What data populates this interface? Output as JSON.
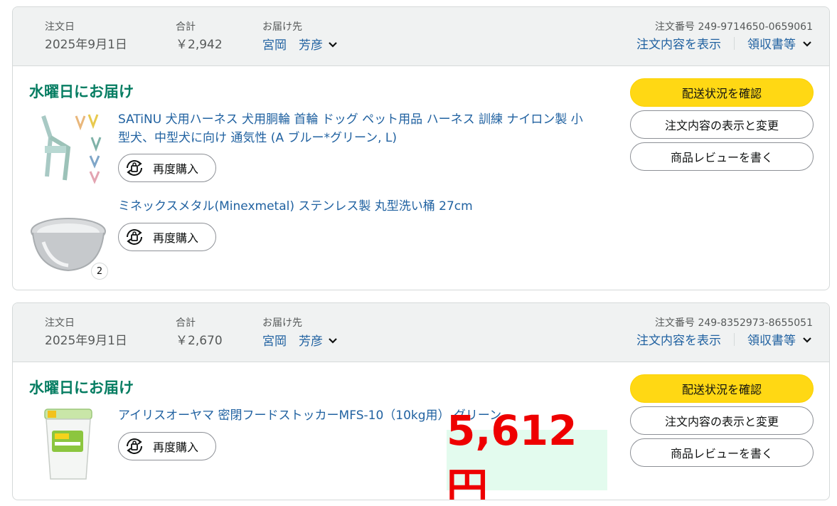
{
  "orders": [
    {
      "date_label": "注文日",
      "date": "2025年9月1日",
      "total_label": "合計",
      "total": "￥2,942",
      "ship_label": "お届け先",
      "ship_to": "宮岡　芳彦",
      "order_no": "注文番号 249-9714650-0659061",
      "view_details": "注文内容を表示",
      "receipt": "領収書等",
      "delivery": "水曜日にお届け",
      "items": [
        {
          "title": "SATiNU 犬用ハーネス 犬用胴輪 首輪 ドッグ ペット用品 ハーネス 訓練 ナイロン製 小型犬、中型犬に向け 通気性 (A ブルー*グリーン, L)",
          "rebuy": "再度購入",
          "image_icon": "harness-image"
        },
        {
          "title": "ミネックスメタル(Minexmetal) ステンレス製 丸型洗い桶 27cm",
          "rebuy": "再度購入",
          "qty": "2",
          "image_icon": "steel-bowl-image"
        }
      ],
      "buttons": {
        "track": "配送状況を確認",
        "edit": "注文内容の表示と変更",
        "review": "商品レビューを書く"
      }
    },
    {
      "date_label": "注文日",
      "date": "2025年9月1日",
      "total_label": "合計",
      "total": "￥2,670",
      "ship_label": "お届け先",
      "ship_to": "宮岡　芳彦",
      "order_no": "注文番号 249-8352973-8655051",
      "view_details": "注文内容を表示",
      "receipt": "領収書等",
      "delivery": "水曜日にお届け",
      "items": [
        {
          "title": "アイリスオーヤマ 密閉フードストッカーMFS-10（10kg用） グリーン",
          "rebuy": "再度購入",
          "image_icon": "food-stocker-image"
        }
      ],
      "buttons": {
        "track": "配送状況を確認",
        "edit": "注文内容の表示と変更",
        "review": "商品レビューを書く"
      }
    }
  ],
  "highlight_price": "5,612円",
  "colors": {
    "link": "#2162a1",
    "delivery": "#067d62",
    "primary_button": "#ffd814",
    "price": "#ee0000",
    "price_bg": "#e3fbee"
  }
}
